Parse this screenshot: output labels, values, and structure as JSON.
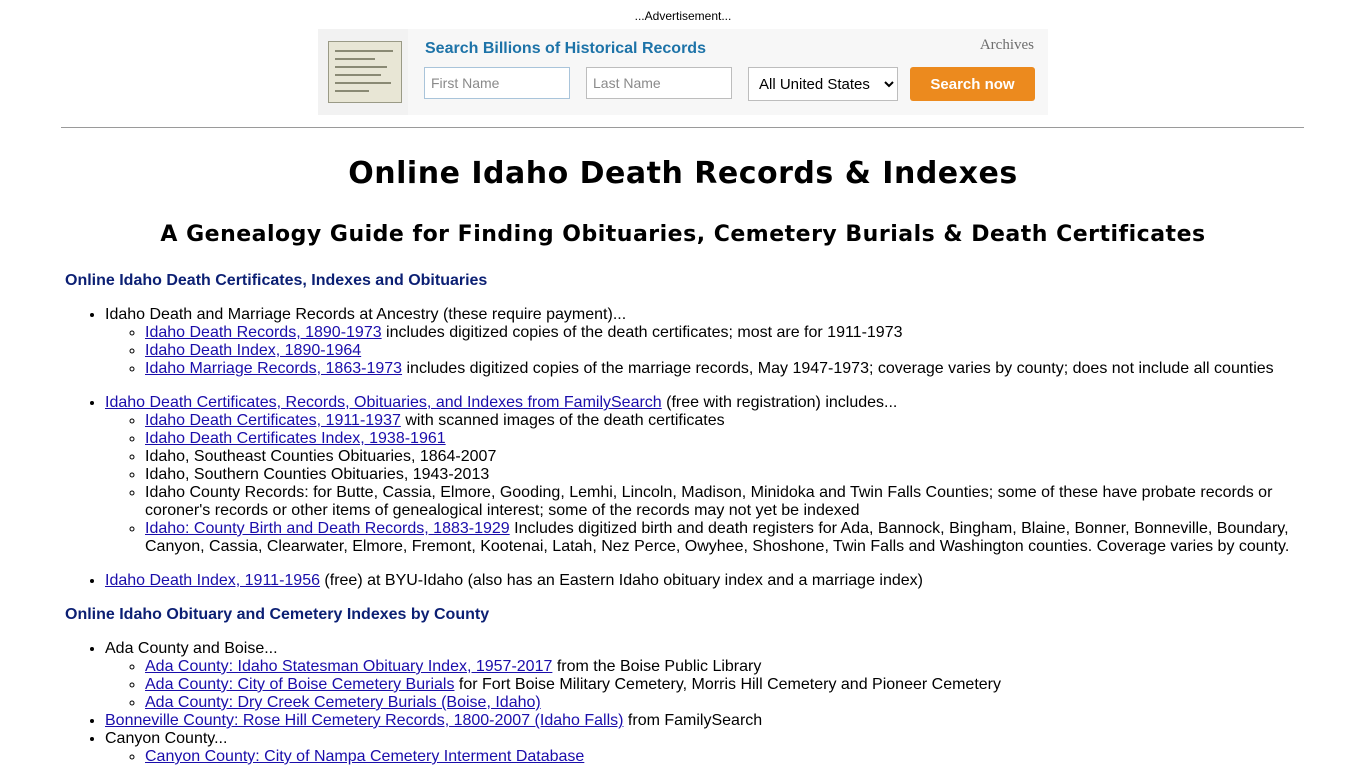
{
  "ad": {
    "label": "...Advertisement...",
    "headline": "Search Billions of Historical Records",
    "brand": "Archives",
    "first_name_placeholder": "First Name",
    "last_name_placeholder": "Last Name",
    "location_selected": "All United States",
    "search_button": "Search now"
  },
  "page": {
    "title": "Online Idaho Death Records & Indexes",
    "subtitle": "A Genealogy Guide for Finding Obituaries, Cemetery Burials & Death Certificates"
  },
  "section1": {
    "heading": "Online Idaho Death Certificates, Indexes and Obituaries",
    "ancestry": {
      "text": "Idaho Death and Marriage Records at Ancestry (these require payment)...",
      "items": [
        {
          "link": "Idaho Death Records, 1890-1973",
          "text": " includes digitized copies of the death certificates; most are for 1911-1973"
        },
        {
          "link": "Idaho Death Index, 1890-1964",
          "text": ""
        },
        {
          "link": "Idaho Marriage Records, 1863-1973",
          "text": " includes digitized copies of the marriage records, May 1947-1973; coverage varies by county; does not include all counties"
        }
      ]
    },
    "familysearch": {
      "link": "Idaho Death Certificates, Records, Obituaries, and Indexes from FamilySearch",
      "text": " (free with registration) includes...",
      "items": [
        {
          "link": "Idaho Death Certificates, 1911-1937",
          "text": " with scanned images of the death certificates"
        },
        {
          "link": "Idaho Death Certificates Index, 1938-1961",
          "text": ""
        },
        {
          "link": "",
          "text": "Idaho, Southeast Counties Obituaries, 1864-2007"
        },
        {
          "link": "",
          "text": "Idaho, Southern Counties Obituaries, 1943-2013"
        },
        {
          "link": "",
          "text": "Idaho County Records: for Butte, Cassia, Elmore, Gooding, Lemhi, Lincoln, Madison, Minidoka and Twin Falls Counties; some of these have probate records or coroner's records or other items of genealogical interest; some of the records may not yet be indexed"
        },
        {
          "link": "Idaho: County Birth and Death Records, 1883-1929",
          "text": " Includes digitized birth and death registers for Ada, Bannock, Bingham, Blaine, Bonner, Bonneville, Boundary, Canyon, Cassia, Clearwater, Elmore, Fremont, Kootenai, Latah, Nez Perce, Owyhee, Shoshone, Twin Falls and Washington counties. Coverage varies by county."
        }
      ]
    },
    "byu": {
      "link": "Idaho Death Index, 1911-1956",
      "text": " (free) at BYU-Idaho (also has an Eastern Idaho obituary index and a marriage index)"
    }
  },
  "section2": {
    "heading": "Online Idaho Obituary and Cemetery Indexes by County",
    "ada": {
      "text": "Ada County and Boise...",
      "items": [
        {
          "link": "Ada County: Idaho Statesman Obituary Index, 1957-2017",
          "text": " from the Boise Public Library"
        },
        {
          "link": "Ada County: City of Boise Cemetery Burials",
          "text": " for Fort Boise Military Cemetery, Morris Hill Cemetery and Pioneer Cemetery"
        },
        {
          "link": "Ada County: Dry Creek Cemetery Burials (Boise, Idaho)",
          "text": ""
        }
      ]
    },
    "bonneville": {
      "link": "Bonneville County: Rose Hill Cemetery Records, 1800-2007 (Idaho Falls)",
      "text": " from FamilySearch"
    },
    "canyon": {
      "text": "Canyon County...",
      "items": [
        {
          "link": "Canyon County: City of Nampa Cemetery Interment Database",
          "text": ""
        }
      ]
    }
  }
}
